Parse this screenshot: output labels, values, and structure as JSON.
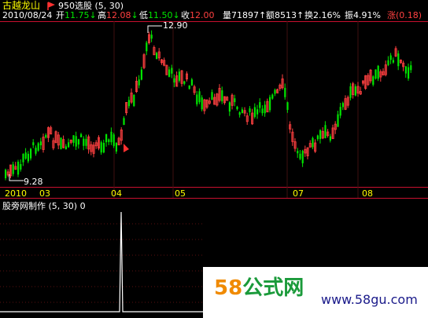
{
  "header": {
    "stock_name": "古越龙山",
    "formula_name": "950选股 (5, 30)",
    "date": "2010/08/24",
    "open_label": "开",
    "open_value": "11.75",
    "high_label": "高",
    "high_value": "12.08",
    "low_label": "低",
    "low_value": "11.50",
    "close_label": "收",
    "close_value": "12.00",
    "vol_label": "量",
    "vol_value": "71897",
    "amount_label": "额",
    "amount_value": "8513",
    "turnover_label": "换",
    "turnover_value": "2.16%",
    "amplitude_label": "振",
    "amplitude_value": "4.91%",
    "change_label": "涨",
    "change_value": "(0.18)"
  },
  "price_chart": {
    "max_annotation": "12.90",
    "min_annotation": "9.28",
    "time_axis": [
      "2010",
      "03",
      "04",
      "05",
      "07",
      "08"
    ]
  },
  "indicator_panel": {
    "title": "股旁网制作 (5, 30) 0"
  },
  "watermark": {
    "brand_num": "58",
    "brand_text": "公式网",
    "url": "www.58gu.com"
  },
  "colors": {
    "up": "#ff4040",
    "down": "#00e600",
    "grid": "#c8102e",
    "accent": "#ffff00"
  }
}
